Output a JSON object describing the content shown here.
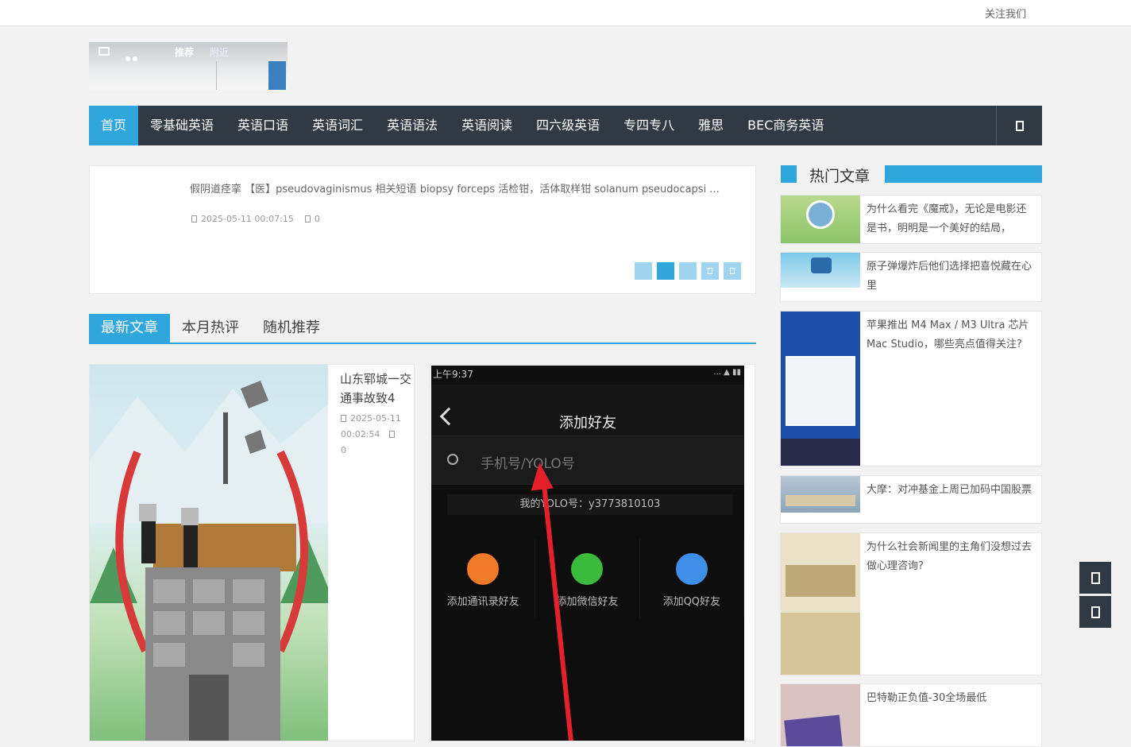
{
  "topbar": {
    "follow_label": "关注我们"
  },
  "logo": {
    "tab_recommend": "推荐",
    "tab_nearby": "附近"
  },
  "nav": {
    "items": [
      "首页",
      "零基础英语",
      "英语口语",
      "英语词汇",
      "英语语法",
      "英语阅读",
      "四六级英语",
      "专四专八",
      "雅思",
      "BEC商务英语"
    ],
    "search_icon": "search-icon"
  },
  "slider": {
    "title": "假阴道痉挛 【医】pseudovaginismus 相关短语 biopsy forceps 活检钳，活体取样钳 solanum pseudocapsi ...",
    "date": "2025-05-11 00:07:15",
    "comments": "0"
  },
  "tabs": [
    "最新文章",
    "本月热评",
    "随机推荐"
  ],
  "posts": [
    {
      "title": "山东郓城一交通事故致4",
      "date": "2025-05-11 00:02:54",
      "comments": "0"
    }
  ],
  "phone": {
    "time": "上午9:37",
    "title": "添加好友",
    "search_placeholder": "手机号/YOLO号",
    "my_id": "我的YOLO号：y3773810103",
    "actions": [
      "添加通讯录好友",
      "添加微信好友",
      "添加QQ好友"
    ]
  },
  "sidebar": {
    "title": "热门文章",
    "items": [
      {
        "title": "为什么看完《魔戒》，无论是电影还是书，明明是一个美好的结局，"
      },
      {
        "title": "原子弹爆炸后他们选择把喜悦藏在心里"
      },
      {
        "title": "苹果推出 M4 Max / M3 Ultra 芯片 Mac Studio，哪些亮点值得关注?"
      },
      {
        "title": "大摩：对冲基金上周已加码中国股票"
      },
      {
        "title": "为什么社会新闻里的主角们没想过去做心理咨询?"
      },
      {
        "title": "巴特勒正负值-30全场最低"
      }
    ]
  },
  "colors": {
    "accent": "#2fa6dc",
    "nav_bg": "#2f3a44"
  }
}
